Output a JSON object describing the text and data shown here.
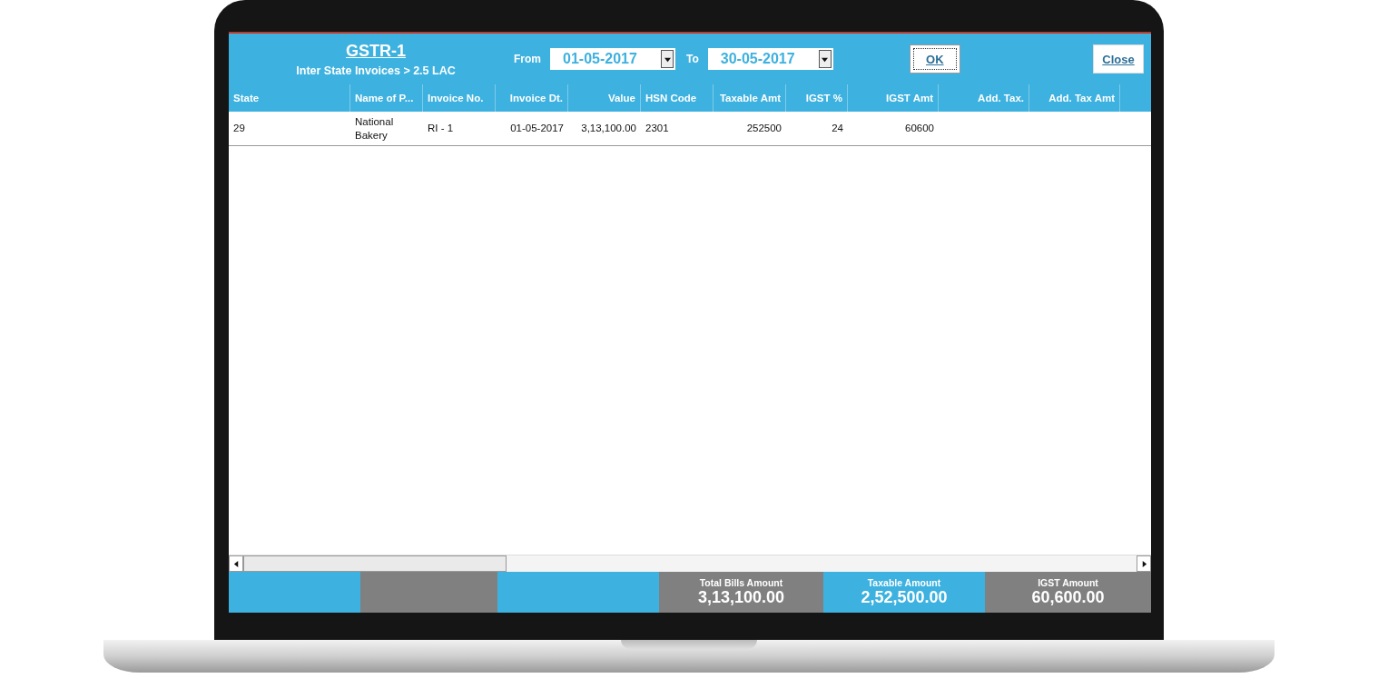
{
  "window": {
    "title": "GSTR-1",
    "subtitle": "Inter State Invoices > 2.5 LAC"
  },
  "filters": {
    "from_label": "From",
    "from_value": "01-05-2017",
    "to_label": "To",
    "to_value": "30-05-2017"
  },
  "buttons": [
    {
      "label": "OK",
      "kind": "ok"
    },
    {
      "label": "Close",
      "kind": "close"
    }
  ],
  "table": {
    "columns": [
      "State",
      "Name of P...",
      "Invoice No.",
      "Invoice Dt.",
      "Value",
      "HSN Code",
      "Taxable Amt",
      "IGST %",
      "IGST Amt",
      "Add. Tax.",
      "Add. Tax Amt"
    ],
    "rows": [
      [
        "29",
        "National Bakery",
        "RI - 1",
        "01-05-2017",
        "3,13,100.00",
        "2301",
        "252500",
        "24",
        "60600",
        "",
        ""
      ]
    ]
  },
  "footer": [
    {
      "color": "#3db1df"
    },
    {
      "color": "#808080"
    },
    {
      "color": "#3db1df"
    },
    {
      "color": "#808080",
      "label": "Total Bills Amount",
      "value": "3,13,100.00"
    },
    {
      "color": "#3db1df",
      "label": "Taxable Amount",
      "value": "2,52,500.00"
    },
    {
      "color": "#808080",
      "label": "IGST Amount",
      "value": "60,600.00"
    }
  ]
}
